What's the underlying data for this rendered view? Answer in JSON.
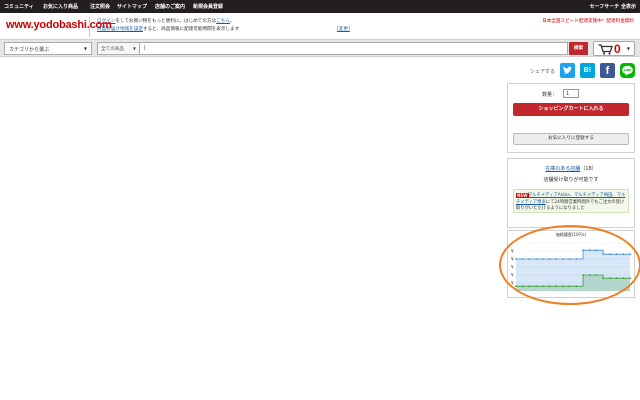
{
  "topnav": {
    "items": [
      "コミュニティ",
      "お気に入り商品",
      "注文照会",
      "サイトマップ",
      "店舗のご案内",
      "新規会員登録"
    ],
    "right": "セーフサーチ 全表示"
  },
  "header": {
    "logo": "www.yodobashi.com",
    "login_msg_1a": "ログイン",
    "login_msg_1b": "をしてお買い物をもっと便利に。はじめての方は",
    "login_msg_1c": "こちら",
    "login_msg_1d": "。",
    "login_msg_2a": "商品お届け地域を設定",
    "login_msg_2b": "すると、商品情報に配達可能時間を表示します",
    "change_link": "[変更]",
    "promo_1": "日本全国スピード配達実施中！配達料金無料"
  },
  "search": {
    "category": "カテゴリから選ぶ",
    "scope": "全ての商品",
    "query": "|",
    "button": "検索",
    "cart_count": "0"
  },
  "share": {
    "label": "シェアする",
    "buttons": [
      "t",
      "B!",
      "f",
      "LINE"
    ]
  },
  "buy": {
    "qty_label": "数量：",
    "qty_value": "1",
    "add_to_cart": "ショッピングカートに入れる",
    "favorite": "お気に入りに登録する"
  },
  "stock": {
    "stores_link": "在庫のある店舗",
    "stores_count": "（18）",
    "pickup": "店舗受け取りが可能です",
    "new_badge": "NEW",
    "note_a": "マルチメディアAkiba、マルチメディア梅田、マルチメディア博多",
    "note_b": "にて24時間営業時間外でもご注文の受け取りがいただけるようになりました"
  },
  "price_history": {
    "title": "価格履歴(10円s)",
    "y_tick_label": "¥"
  },
  "colors": {
    "nav_bg": "#231f20",
    "brand_red": "#cc0000",
    "button_red": "#c1272d",
    "twitter": "#1da1f2",
    "hatena": "#00a4de",
    "facebook": "#3b5998",
    "line": "#00b900",
    "highlight": "#f07d22",
    "series_blue": "#4a90d9",
    "series_green": "#3ca03c"
  },
  "chart_data": {
    "type": "area",
    "title": "価格履歴(10円s)",
    "x": [
      0,
      1,
      2,
      3,
      4,
      5,
      6,
      7,
      8,
      9,
      10,
      11,
      12,
      13,
      14,
      15,
      16,
      17
    ],
    "series": [
      {
        "values": [
          6,
          6,
          6,
          6,
          6,
          6,
          6,
          6,
          6,
          6,
          7.1,
          7.1,
          7.1,
          6.6,
          6.6,
          6.6,
          6.6,
          6.6
        ]
      },
      {
        "values": [
          2.6,
          2.6,
          2.6,
          2.6,
          2.6,
          2.6,
          2.6,
          2.6,
          2.6,
          2.6,
          4,
          4,
          4,
          3.6,
          3.6,
          3.6,
          3.6,
          3.6
        ]
      }
    ],
    "ylim": [
      2,
      8
    ],
    "grid": true
  }
}
